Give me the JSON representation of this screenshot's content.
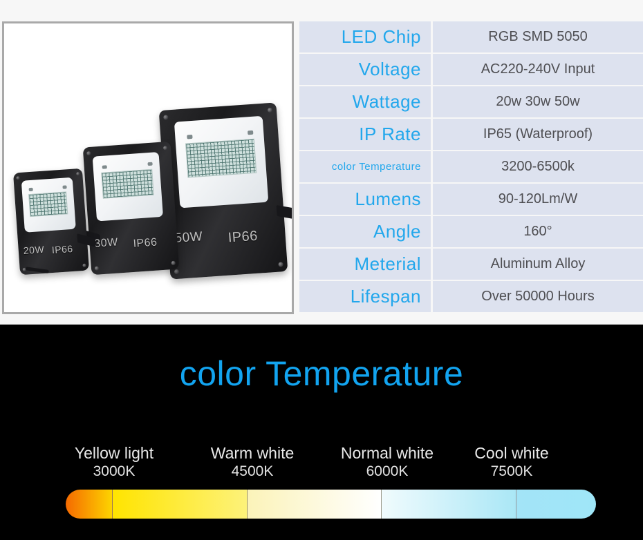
{
  "spec": {
    "rows": [
      {
        "key": "LED  Chip",
        "value": "RGB SMD 5050",
        "small": false
      },
      {
        "key": "Voltage",
        "value": "AC220-240V Input",
        "small": false
      },
      {
        "key": "Wattage",
        "value": "20w 30w 50w",
        "small": false
      },
      {
        "key": "IP  Rate",
        "value": "IP65 (Waterproof)",
        "small": false
      },
      {
        "key": "color  Temperature",
        "value": "3200-6500k",
        "small": true
      },
      {
        "key": "Lumens",
        "value": "90-120Lm/W",
        "small": false
      },
      {
        "key": "Angle",
        "value": "160°",
        "small": false
      },
      {
        "key": "Meterial",
        "value": "Aluminum Alloy",
        "small": false
      },
      {
        "key": "Lifespan",
        "value": "Over 50000 Hours",
        "small": false
      }
    ],
    "key_color": "#22a7ec",
    "value_color": "#4e4e52",
    "cell_bg": "#dde2ef"
  },
  "photo": {
    "lights": [
      {
        "watt": "20W",
        "ip": "IP66"
      },
      {
        "watt": "30W",
        "ip": "IP66"
      },
      {
        "watt": "50W",
        "ip": "IP66"
      }
    ]
  },
  "temperature": {
    "title": "color Temperature",
    "title_color": "#12a4f0",
    "background": "#000000",
    "labels": [
      {
        "name": "Yellow light",
        "kelvin": "3000K"
      },
      {
        "name": "Warm white",
        "kelvin": "4500K"
      },
      {
        "name": "Normal white",
        "kelvin": "6000K"
      },
      {
        "name": "Cool white",
        "kelvin": "7500K"
      }
    ],
    "gradient_segments": [
      {
        "from": "#f56a00",
        "to": "#fdd400"
      },
      {
        "from": "#ffe400",
        "to": "#fdf27a"
      },
      {
        "from": "#fbf3b9",
        "to": "#ffffff"
      },
      {
        "from": "#f0fbfd",
        "to": "#aae7f6"
      },
      {
        "from": "#a3e4f7",
        "to": "#9fe6f8"
      }
    ]
  }
}
